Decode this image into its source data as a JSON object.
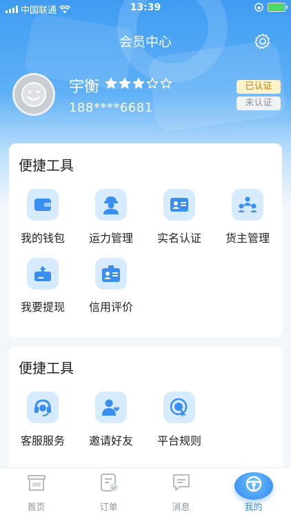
{
  "status_bar": {
    "carrier": "中国联通",
    "time": "13:39"
  },
  "header": {
    "title": "会员中心"
  },
  "profile": {
    "name": "宇衡",
    "rating": 3,
    "rating_max": 5,
    "phone": "188****6681",
    "verified_label": "已认证",
    "unverified_label": "未认证"
  },
  "quick_tools": {
    "title": "便捷工具",
    "items": [
      {
        "label": "我的钱包",
        "icon": "wallet-icon"
      },
      {
        "label": "运力管理",
        "icon": "driver-icon"
      },
      {
        "label": "实名认证",
        "icon": "id-card-icon"
      },
      {
        "label": "货主管理",
        "icon": "group-icon"
      },
      {
        "label": "我要提现",
        "icon": "withdraw-icon"
      },
      {
        "label": "信用评价",
        "icon": "credit-badge-icon"
      }
    ]
  },
  "service_tools": {
    "title": "便捷工具",
    "items": [
      {
        "label": "客服服务",
        "icon": "headset-icon"
      },
      {
        "label": "邀请好友",
        "icon": "invite-friend-icon"
      },
      {
        "label": "平台规则",
        "icon": "rules-icon"
      }
    ]
  },
  "tabbar": {
    "items": [
      {
        "label": "首页",
        "icon": "home-icon"
      },
      {
        "label": "订单",
        "icon": "order-icon"
      },
      {
        "label": "消息",
        "icon": "message-icon"
      },
      {
        "label": "我的",
        "icon": "steering-wheel-icon"
      }
    ],
    "active_index": 3
  },
  "colors": {
    "accent": "#3a8ef0",
    "icon_bg": "#d6ebfd",
    "verified": "#b9870d"
  }
}
